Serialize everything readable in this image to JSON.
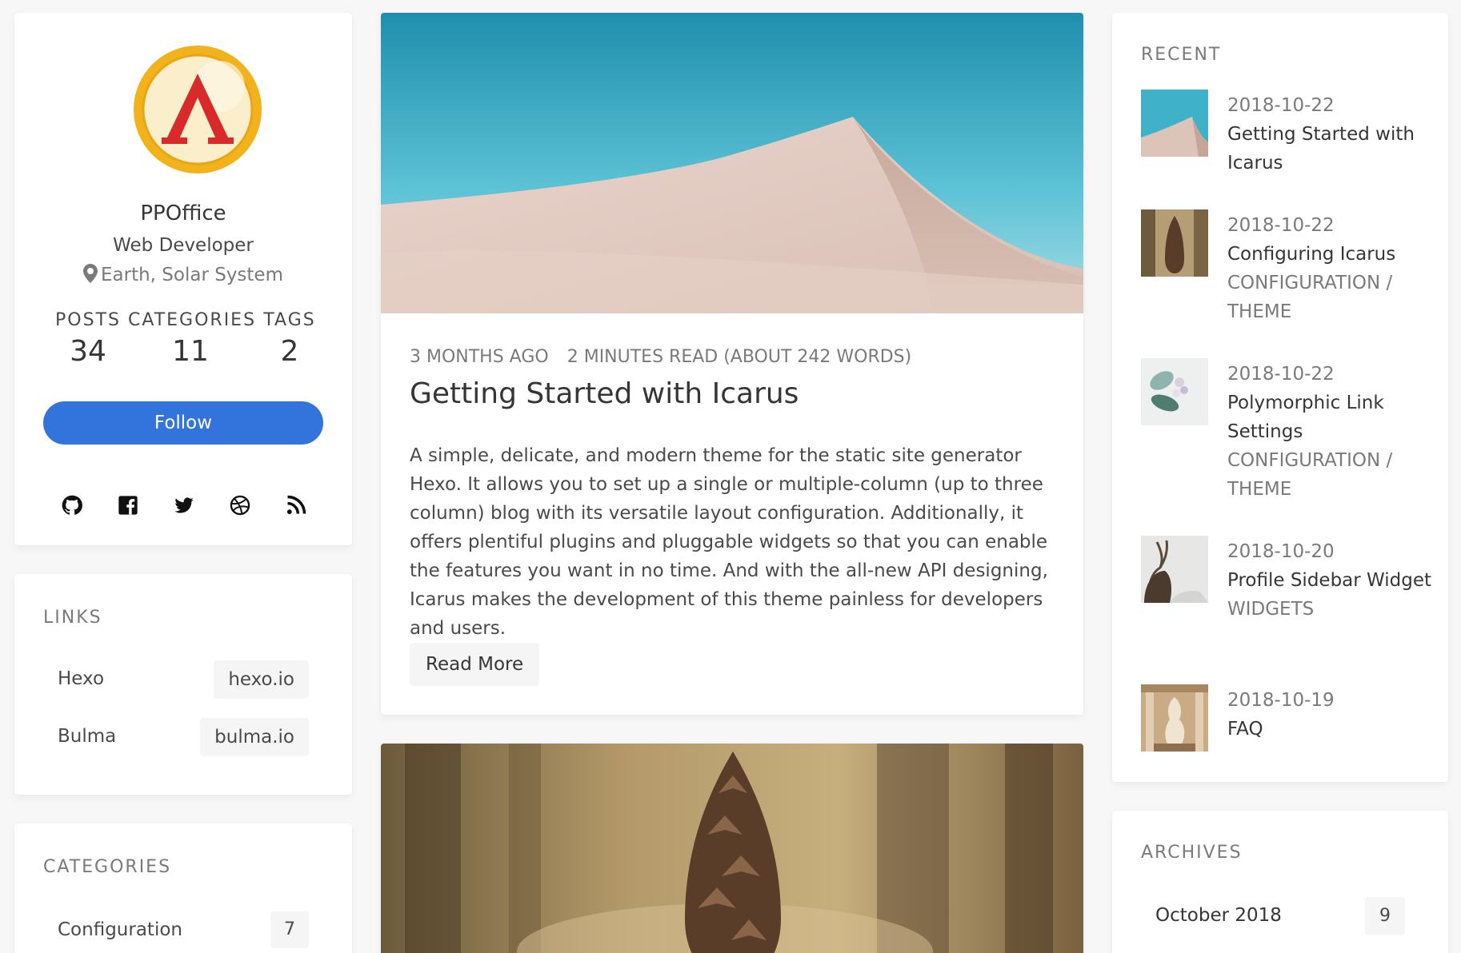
{
  "profile": {
    "name": "PPOffice",
    "title": "Web Developer",
    "location": "Earth, Solar System",
    "stats": [
      {
        "label": "POSTS",
        "value": "34"
      },
      {
        "label": "CATEGORIES",
        "value": "11"
      },
      {
        "label": "TAGS",
        "value": "2"
      }
    ],
    "follow_label": "Follow",
    "socials": [
      "github-icon",
      "facebook-icon",
      "twitter-icon",
      "dribbble-icon",
      "rss-icon"
    ],
    "accent": "#3273dc"
  },
  "links": {
    "title": "LINKS",
    "items": [
      {
        "name": "Hexo",
        "url": "hexo.io"
      },
      {
        "name": "Bulma",
        "url": "bulma.io"
      }
    ]
  },
  "categories": {
    "title": "CATEGORIES",
    "items": [
      {
        "name": "Configuration",
        "count": "7"
      }
    ]
  },
  "post": {
    "date": "3 MONTHS AGO",
    "read_time": "2 MINUTES READ (ABOUT 242 WORDS)",
    "title": "Getting Started with Icarus",
    "excerpt": "A simple, delicate, and modern theme for the static site generator Hexo. It allows you to set up a single or multiple-column (up to three column) blog with its versatile layout configuration. Additionally, it offers plentiful plugins and pluggable widgets so that you can enable the features you want in no time. And with the all-new API designing, Icarus makes the development of this theme painless for developers and users.",
    "read_more": "Read More"
  },
  "recent": {
    "title": "RECENT",
    "items": [
      {
        "date": "2018-10-22",
        "title": "Getting Started with Icarus",
        "category": ""
      },
      {
        "date": "2018-10-22",
        "title": "Configuring Icarus",
        "category": "CONFIGURATION / THEME"
      },
      {
        "date": "2018-10-22",
        "title": "Polymorphic Link Settings",
        "category": "CONFIGURATION / THEME"
      },
      {
        "date": "2018-10-20",
        "title": "Profile Sidebar Widget",
        "category": "WIDGETS"
      },
      {
        "date": "2018-10-19",
        "title": "FAQ",
        "category": ""
      }
    ]
  },
  "archives": {
    "title": "ARCHIVES",
    "items": [
      {
        "name": "October 2018",
        "count": "9"
      }
    ]
  }
}
